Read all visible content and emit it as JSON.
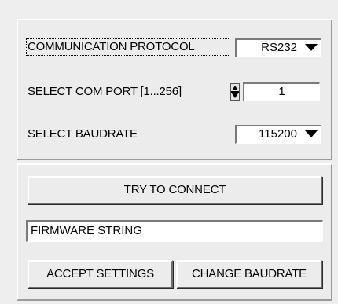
{
  "settings": {
    "protocol_label": "COMMUNICATION PROTOCOL",
    "protocol_value": "RS232",
    "com_port_label": "SELECT COM PORT [1...256]",
    "com_port_value": "1",
    "baudrate_label": "SELECT BAUDRATE",
    "baudrate_value": "115200"
  },
  "connection": {
    "connect_button": "TRY TO CONNECT",
    "firmware_string": "FIRMWARE STRING",
    "accept_button": "ACCEPT SETTINGS",
    "change_baudrate_button": "CHANGE BAUDRATE"
  },
  "icons": {
    "dropdown": "triangle-down-icon",
    "spinner": "up-down-spinner-icon"
  }
}
